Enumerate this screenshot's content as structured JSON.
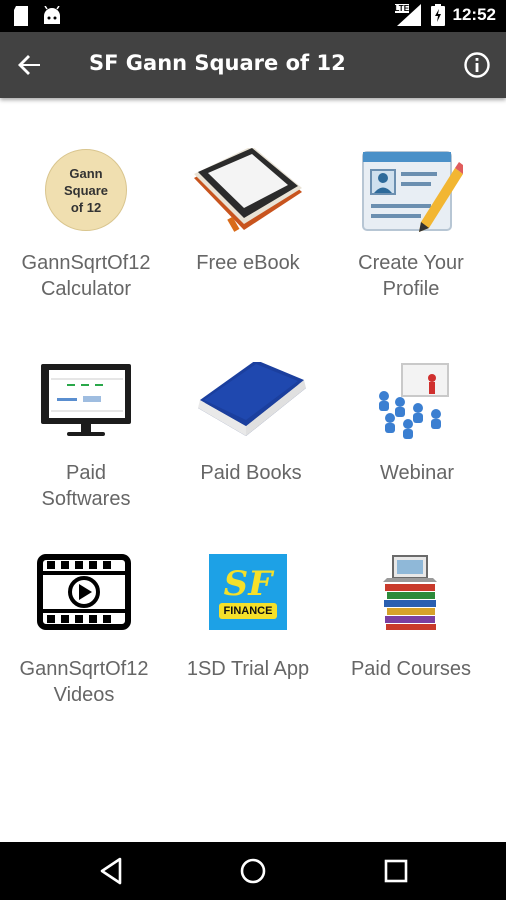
{
  "status_bar": {
    "time": "12:52",
    "network_label": "LTE",
    "icons": [
      "sd-card-icon",
      "android-icon",
      "signal-icon",
      "battery-icon"
    ]
  },
  "app_bar": {
    "title": "SF Gann Square of 12",
    "background": "#424242",
    "icons": [
      "back-arrow-icon",
      "info-icon"
    ]
  },
  "gann_logo": {
    "line1": "Gann",
    "line2": "Square",
    "line3": "of 12"
  },
  "sf_logo": {
    "letters": "SF",
    "word": "FINANCE"
  },
  "tiles": [
    {
      "line1": "GannSqrtOf12",
      "line2": "Calculator",
      "icon": "gann-logo-icon"
    },
    {
      "line1": "Free eBook",
      "line2": "",
      "icon": "ebook-reader-icon"
    },
    {
      "line1": "Create Your",
      "line2": "Profile",
      "icon": "profile-form-icon"
    },
    {
      "line1": "Paid",
      "line2": "Softwares",
      "icon": "monitor-icon"
    },
    {
      "line1": "Paid Books",
      "line2": "",
      "icon": "book-icon"
    },
    {
      "line1": "Webinar",
      "line2": "",
      "icon": "webinar-icon"
    },
    {
      "line1": "GannSqrtOf12",
      "line2": "Videos",
      "icon": "video-film-icon"
    },
    {
      "line1": "1SD Trial App",
      "line2": "",
      "icon": "sf-finance-logo-icon"
    },
    {
      "line1": "Paid Courses",
      "line2": "",
      "icon": "books-laptop-icon"
    }
  ],
  "nav_bar": {
    "icons": [
      "nav-back-icon",
      "nav-home-icon",
      "nav-recents-icon"
    ]
  }
}
